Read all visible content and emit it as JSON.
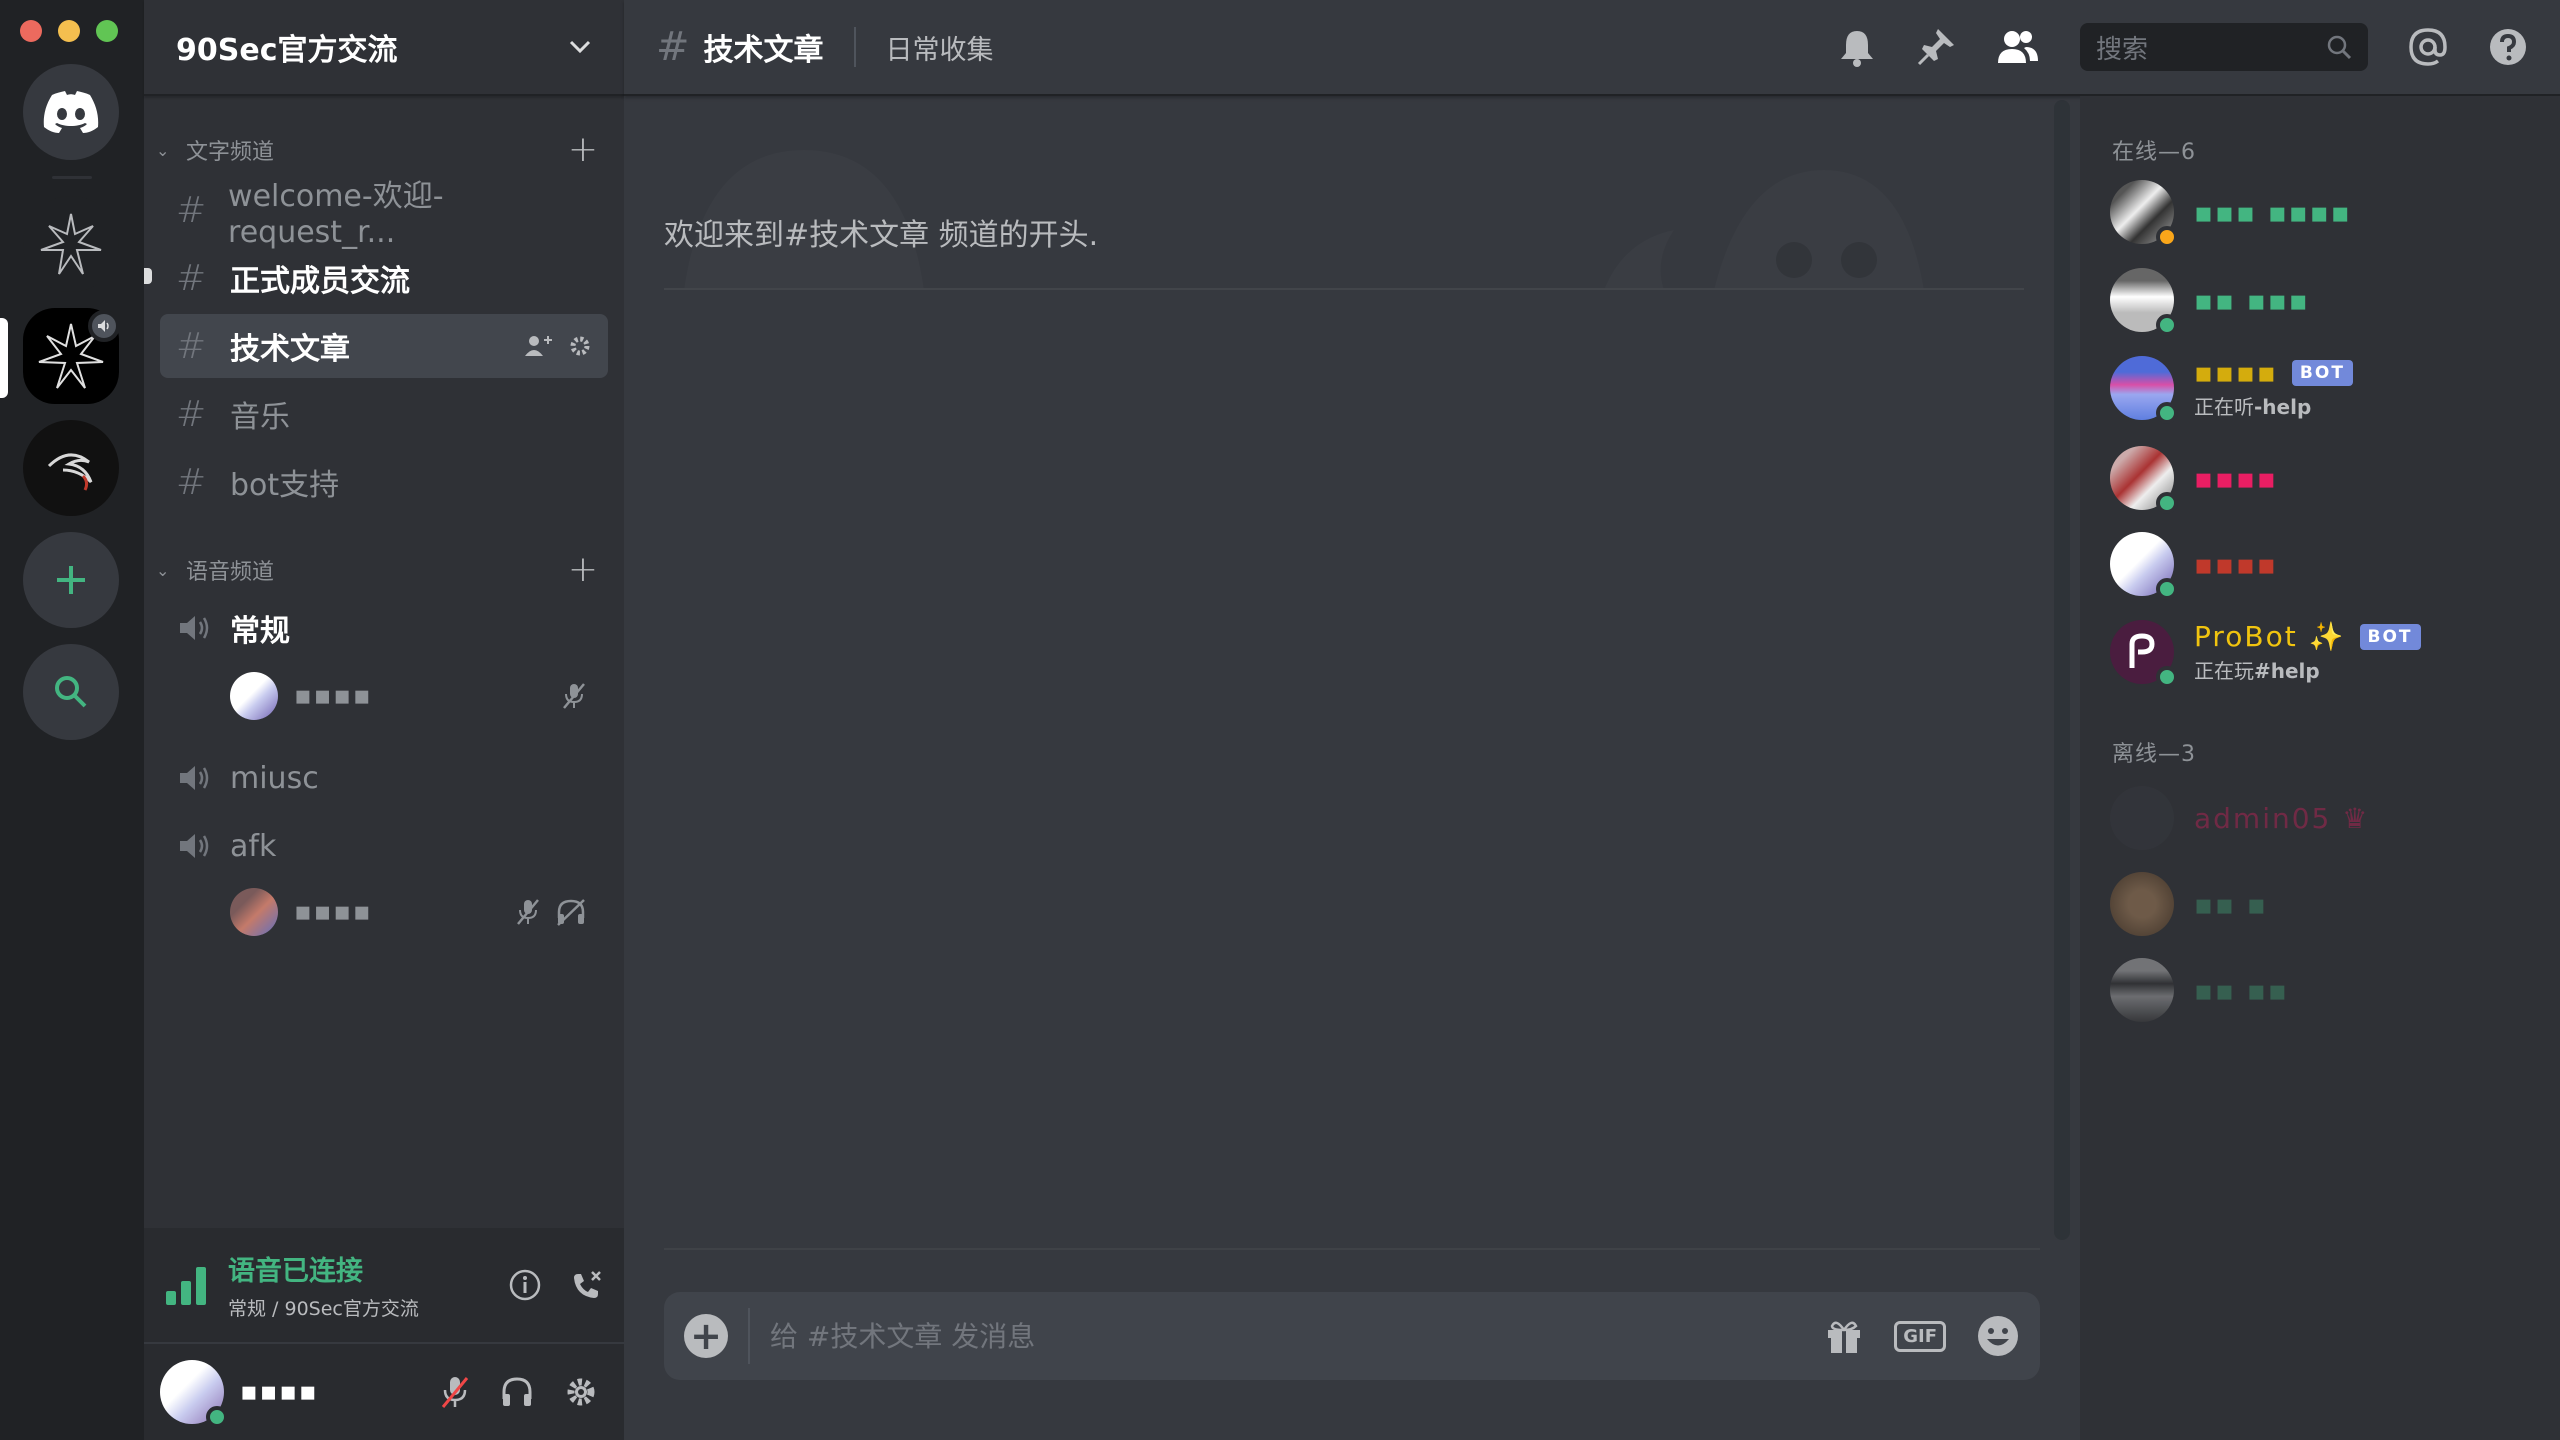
{
  "server_header": {
    "name": "90Sec官方交流"
  },
  "categories": {
    "text": {
      "label": "文字频道"
    },
    "voice": {
      "label": "语音频道"
    }
  },
  "text_channels": [
    {
      "name": "welcome-欢迎-request_r..."
    },
    {
      "name": "正式成员交流"
    },
    {
      "name": "技术文章"
    },
    {
      "name": "音乐"
    },
    {
      "name": "bot支持"
    }
  ],
  "voice_channels": [
    {
      "name": "常规",
      "users": [
        {
          "name": "▪▪▪▪"
        }
      ]
    },
    {
      "name": "miusc"
    },
    {
      "name": "afk",
      "users": [
        {
          "name": "▪▪▪▪"
        }
      ]
    }
  ],
  "voice_panel": {
    "status": "语音已连接",
    "location": "常规 / 90Sec官方交流"
  },
  "user_panel": {
    "username": "▪▪▪▪"
  },
  "channel_header": {
    "name": "技术文章",
    "topic": "日常收集"
  },
  "search": {
    "placeholder": "搜索"
  },
  "chat": {
    "welcome": "欢迎来到#技术文章 频道的开头."
  },
  "composer": {
    "placeholder": "给 #技术文章 发消息"
  },
  "members": {
    "online_label": "在线—6",
    "offline_label": "离线—3",
    "online": [
      {
        "name": "▪▪▪ ▪▪▪▪",
        "color": "#43b581"
      },
      {
        "name": "▪▪ ▪▪▪",
        "color": "#43b581"
      },
      {
        "name": "▪▪▪▪",
        "color": "#d4ac0d",
        "bot": "BOT",
        "activity": "正在听",
        "activity_target": "-help"
      },
      {
        "name": "▪▪▪▪",
        "color": "#e91e63"
      },
      {
        "name": "▪▪▪▪",
        "color": "#c0392b"
      },
      {
        "name": "ProBot ✨",
        "color": "#f1c40f",
        "bot": "BOT",
        "activity": "正在玩",
        "activity_target": "#help"
      }
    ],
    "offline": [
      {
        "name": "admin05 ♛",
        "color": "#e91e63"
      },
      {
        "name": "▪▪ ▪",
        "color": "#43b581"
      },
      {
        "name": "▪▪ ▪▪",
        "color": "#43b581"
      }
    ]
  },
  "colors": {
    "accent": "#7289da",
    "online": "#43b581",
    "background": "#36393f",
    "sidebar": "#2f3136",
    "rail": "#202225"
  }
}
